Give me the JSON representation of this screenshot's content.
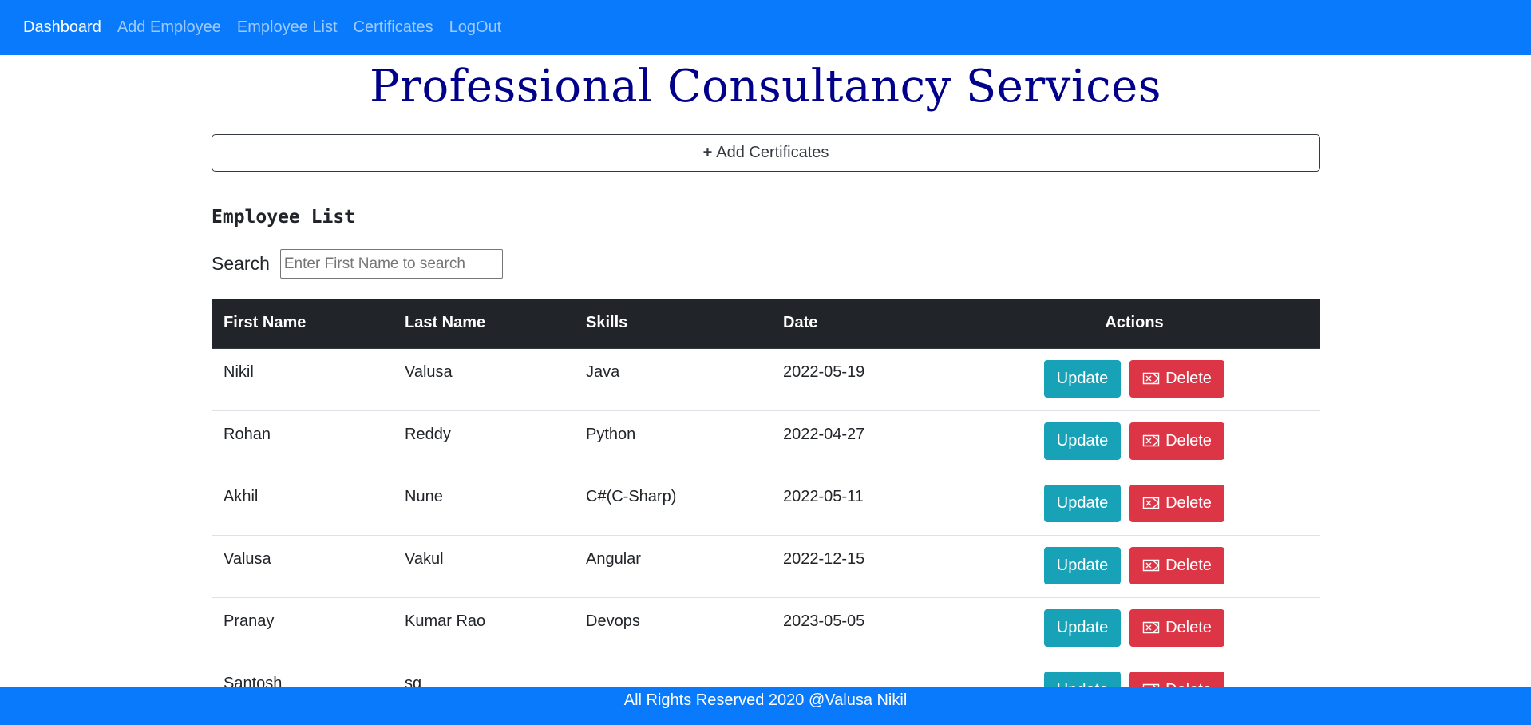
{
  "nav": {
    "items": [
      {
        "label": "Dashboard",
        "active": true
      },
      {
        "label": "Add Employee",
        "active": false
      },
      {
        "label": "Employee List",
        "active": false
      },
      {
        "label": "Certificates",
        "active": false
      },
      {
        "label": "LogOut",
        "active": false
      }
    ]
  },
  "title": "Professional Consultancy Services",
  "add_certificates": {
    "icon": "plus-icon",
    "label": "Add Certificates"
  },
  "section_heading": "Employee List",
  "search": {
    "label": "Search",
    "placeholder": "Enter First Name to search",
    "value": ""
  },
  "table": {
    "headers": [
      "First Name",
      "Last Name",
      "Skills",
      "Date",
      "Actions"
    ],
    "rows": [
      {
        "first": "Nikil",
        "last": "Valusa",
        "skills": "Java",
        "date": "2022-05-19"
      },
      {
        "first": "Rohan",
        "last": "Reddy",
        "skills": "Python",
        "date": "2022-04-27"
      },
      {
        "first": "Akhil",
        "last": "Nune",
        "skills": "C#(C-Sharp)",
        "date": "2022-05-11"
      },
      {
        "first": "Valusa",
        "last": "Vakul",
        "skills": "Angular",
        "date": "2022-12-15"
      },
      {
        "first": "Pranay",
        "last": "Kumar Rao",
        "skills": "Devops",
        "date": "2023-05-05"
      },
      {
        "first": "Santosh",
        "last": "sg",
        "skills": "",
        "date": ""
      }
    ],
    "update_label": "Update",
    "delete_label": "Delete",
    "delete_icon": "backspace-x-icon"
  },
  "footer": "All Rights Reserved 2020 @Valusa Nikil",
  "colors": {
    "navbar": "#0a7afc",
    "title": "#00008b",
    "update": "#17a2b8",
    "delete": "#dc3545",
    "table_header": "#212529"
  }
}
